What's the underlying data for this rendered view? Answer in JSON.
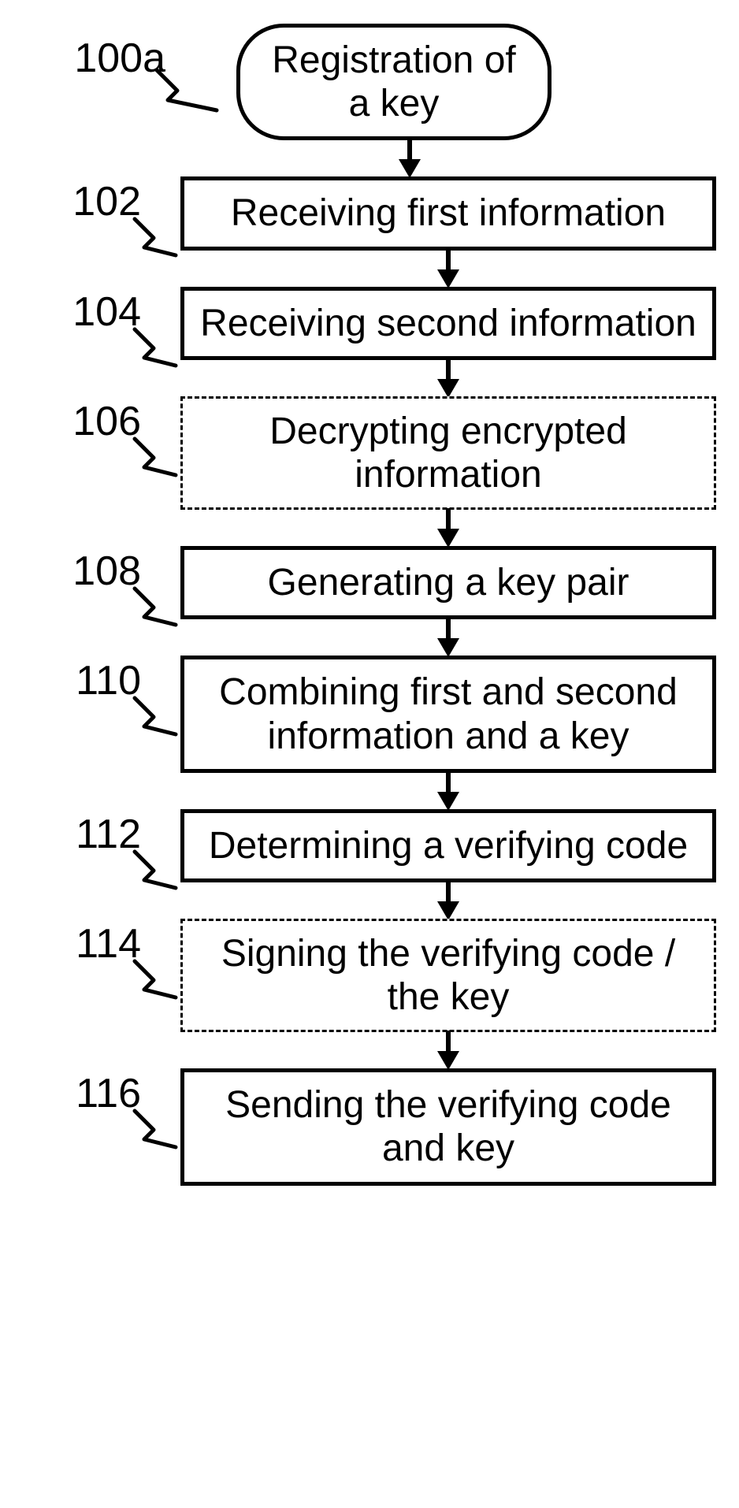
{
  "flow": {
    "start": {
      "ref": "100a",
      "text": "Registration of a key"
    },
    "steps": [
      {
        "ref": "102",
        "text": "Receiving first information",
        "dashed": false
      },
      {
        "ref": "104",
        "text": "Receiving second information",
        "dashed": false
      },
      {
        "ref": "106",
        "text": "Decrypting encrypted information",
        "dashed": true
      },
      {
        "ref": "108",
        "text": "Generating a key pair",
        "dashed": false
      },
      {
        "ref": "110",
        "text": "Combining first and second information and a key",
        "dashed": false
      },
      {
        "ref": "112",
        "text": "Determining a verifying code",
        "dashed": false
      },
      {
        "ref": "114",
        "text": "Signing the verifying code / the key",
        "dashed": true
      },
      {
        "ref": "116",
        "text": "Sending the verifying code and key",
        "dashed": false
      }
    ]
  }
}
